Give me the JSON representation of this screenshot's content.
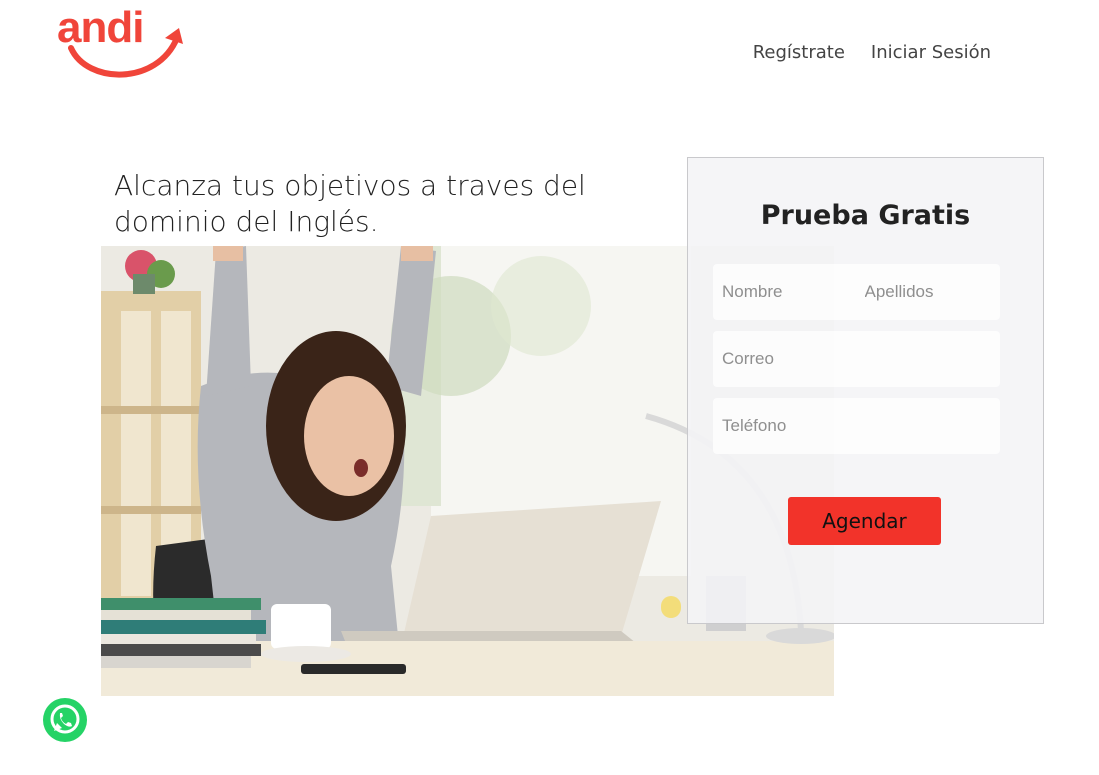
{
  "brand": {
    "name": "andi",
    "color": "#f0453a"
  },
  "nav": {
    "register": "Regístrate",
    "login": "Iniciar Sesión"
  },
  "hero": {
    "headline": "Alcanza tus objetivos a traves del dominio del Inglés.",
    "image_alt": "photo-woman-celebrating-laptop"
  },
  "form": {
    "title": "Prueba Gratis",
    "first_name_placeholder": "Nombre",
    "last_name_placeholder": "Apellidos",
    "email_placeholder": "Correo",
    "phone_placeholder": "Teléfono",
    "submit_label": "Agendar",
    "submit_color": "#f2332a"
  },
  "floating": {
    "whatsapp_icon": "whatsapp-icon",
    "whatsapp_color": "#25d366"
  }
}
